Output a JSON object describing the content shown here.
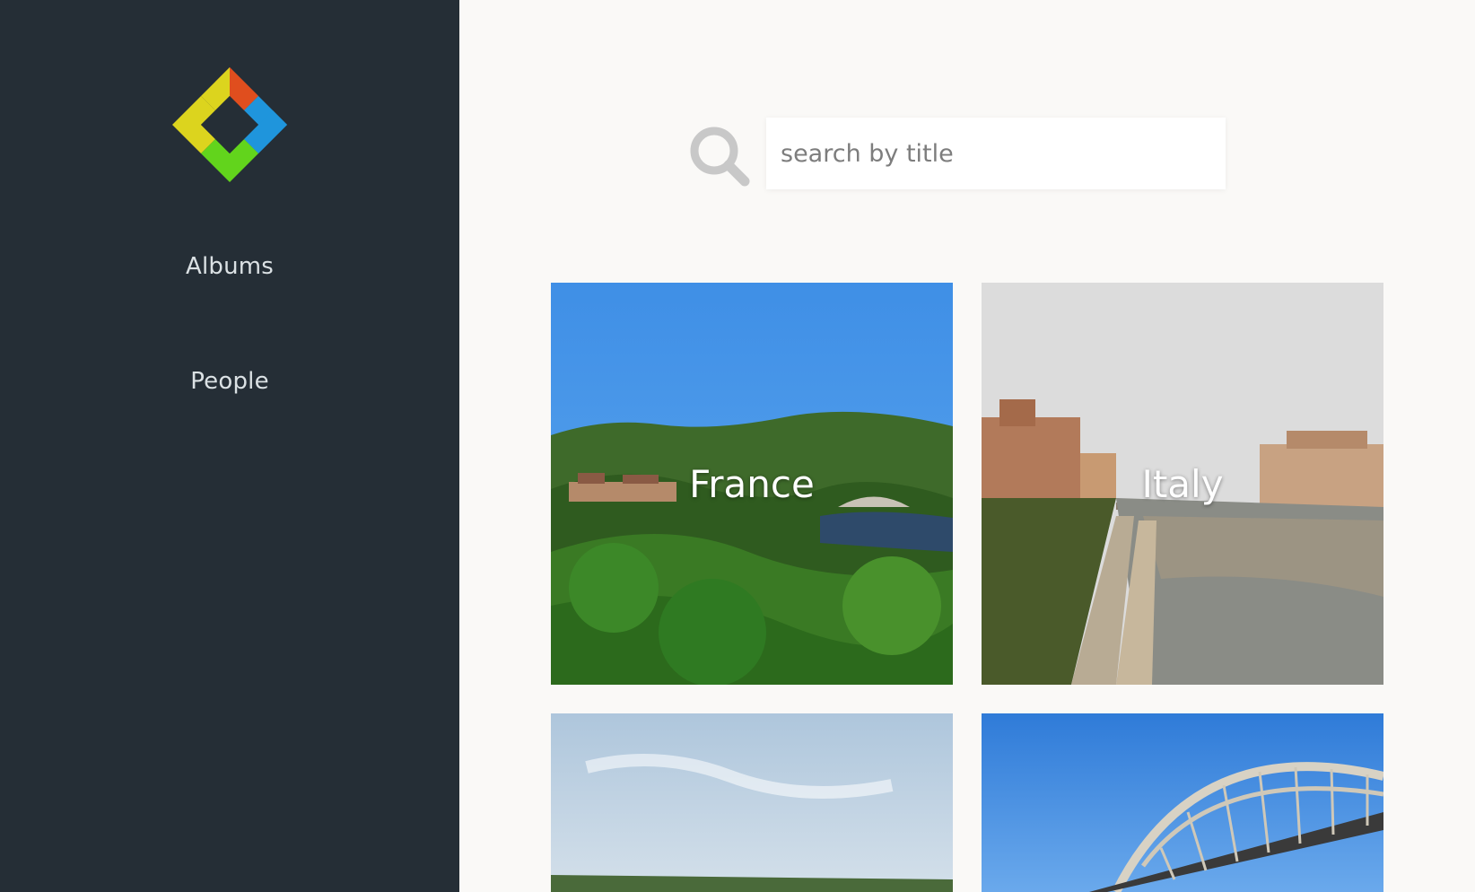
{
  "sidebar": {
    "logo": "colorful-diamond-logo",
    "items": [
      {
        "label": "Albums"
      },
      {
        "label": "People"
      }
    ]
  },
  "search": {
    "icon": "search-icon",
    "placeholder": "search by title",
    "value": ""
  },
  "albums": [
    {
      "title": "France"
    },
    {
      "title": "Italy"
    },
    {
      "title": ""
    },
    {
      "title": ""
    }
  ],
  "colors": {
    "sidebar_bg": "#252e36",
    "main_bg": "#faf9f7",
    "nav_text": "#dbe1e4",
    "logo_orange": "#e04e1e",
    "logo_yellow": "#dcd41e",
    "logo_green": "#62d41c",
    "logo_blue": "#1f95dc"
  }
}
